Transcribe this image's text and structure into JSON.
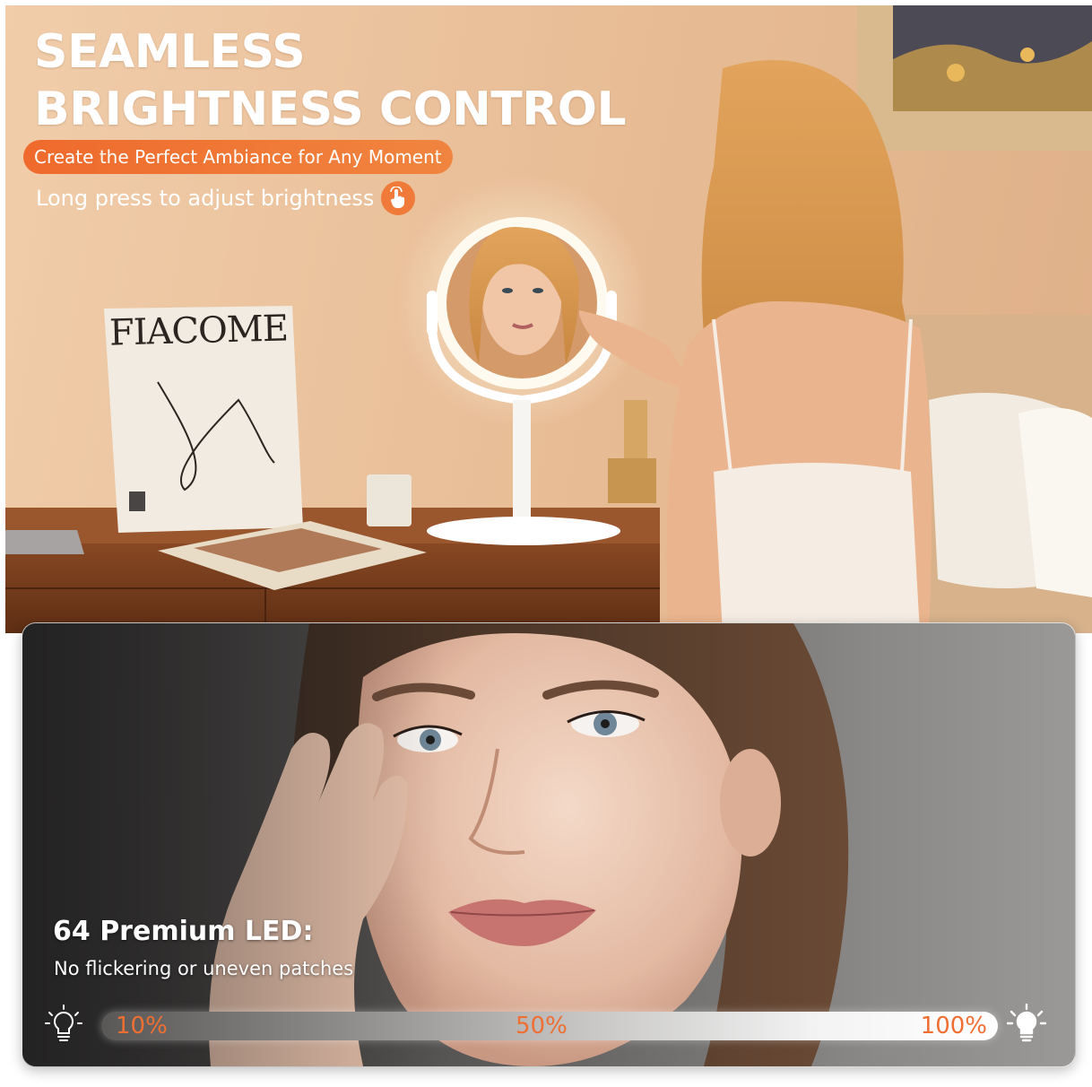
{
  "headline": {
    "line1": "SEAMLESS",
    "line2": "BRIGHTNESS CONTROL"
  },
  "tagline": "Create the Perfect Ambiance for Any Moment",
  "hint": "Long press to adjust brightness",
  "book_brand": "FIACOME",
  "led": {
    "title": "64 Premium LED:",
    "subtitle": "No flickering or uneven patches"
  },
  "brightness_scale": {
    "min_label": "10%",
    "mid_label": "50%",
    "max_label": "100%"
  },
  "colors": {
    "accent_orange": "#ef6a2c",
    "label_orange": "#ef6f33"
  },
  "icons": {
    "hint": "tap-hand-icon",
    "min": "dim-bulb-icon",
    "max": "bright-bulb-icon"
  }
}
